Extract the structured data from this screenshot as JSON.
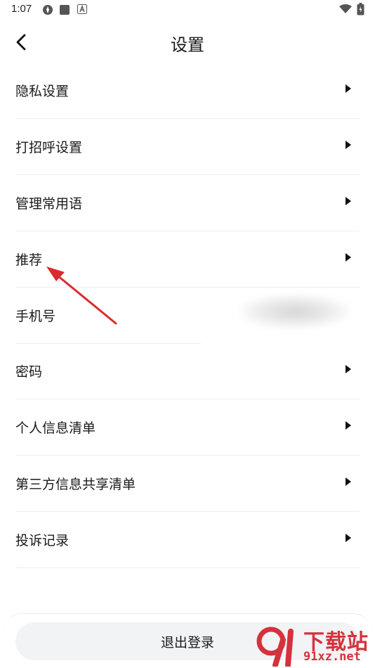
{
  "status_bar": {
    "time": "1:07"
  },
  "header": {
    "title": "设置"
  },
  "settings": {
    "items": [
      {
        "label": "隐私设置",
        "has_chevron": true
      },
      {
        "label": "打招呼设置",
        "has_chevron": true
      },
      {
        "label": "管理常用语",
        "has_chevron": true
      },
      {
        "label": "推荐",
        "has_chevron": true
      },
      {
        "label": "手机号",
        "has_chevron": false
      },
      {
        "label": "密码",
        "has_chevron": true
      },
      {
        "label": "个人信息清单",
        "has_chevron": true
      },
      {
        "label": "第三方信息共享清单",
        "has_chevron": true
      },
      {
        "label": "投诉记录",
        "has_chevron": true
      }
    ]
  },
  "footer": {
    "logout_label": "退出登录"
  },
  "watermark": {
    "site_name": "下载站",
    "url": "91xz.net"
  },
  "colors": {
    "annotation_arrow": "#d92c2c",
    "watermark": "#d4323c",
    "logout_bg": "#f2f3f5",
    "divider": "#eeeeee"
  },
  "icons": {
    "back": "back-chevron-icon",
    "row_arrow": "triangle-right-icon"
  }
}
